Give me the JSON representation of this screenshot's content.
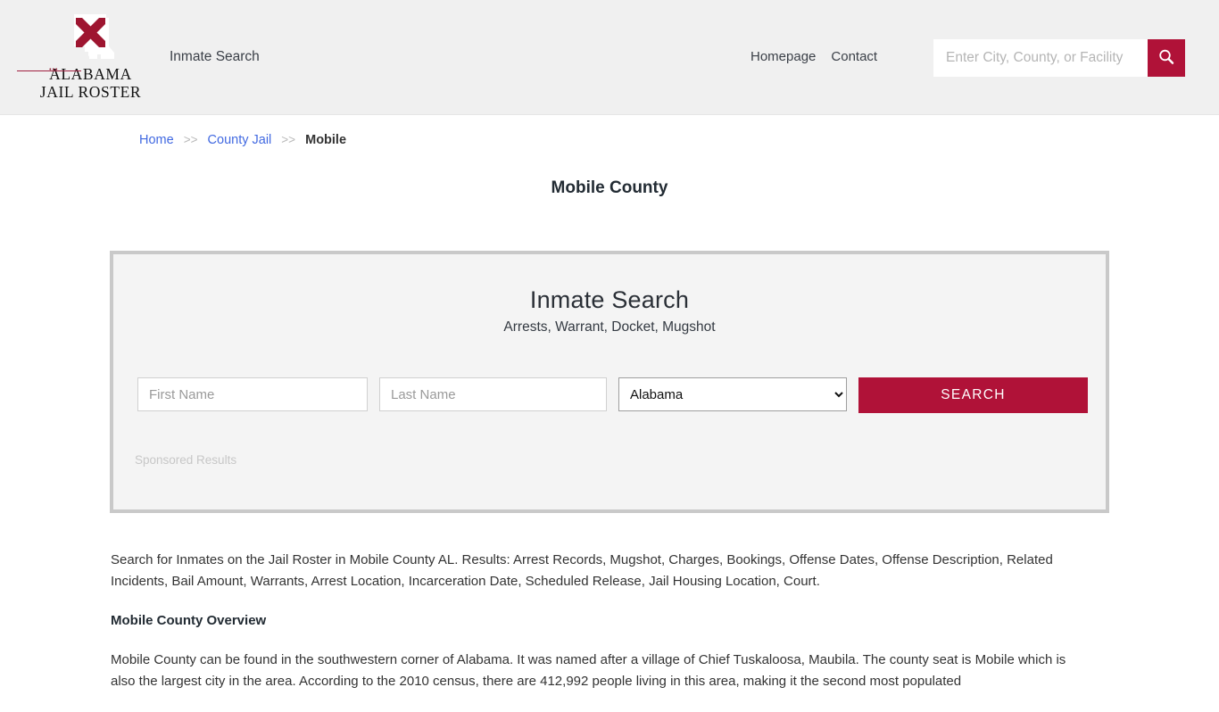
{
  "header": {
    "brand": {
      "line1": "ALABAMA",
      "line2": "JAIL ROSTER",
      "rule_dots": "•••",
      "logo_icon": "alabama-state-flag-icon"
    },
    "tagline": "Inmate Search",
    "nav": [
      {
        "label": "Homepage"
      },
      {
        "label": "Contact"
      }
    ],
    "search": {
      "placeholder": "Enter City, County, or Facility",
      "value": "",
      "button_icon": "search-icon"
    }
  },
  "breadcrumb": {
    "items": [
      {
        "label": "Home",
        "link": true
      },
      {
        "label": "County Jail",
        "link": true
      },
      {
        "label": "Mobile",
        "link": false
      }
    ],
    "separator": ">>"
  },
  "page": {
    "title": "Mobile County"
  },
  "search_panel": {
    "title": "Inmate Search",
    "subtitle": "Arrests, Warrant, Docket, Mugshot",
    "first_name": {
      "placeholder": "First Name",
      "value": ""
    },
    "last_name": {
      "placeholder": "Last Name",
      "value": ""
    },
    "state": {
      "selected": "Alabama",
      "options": [
        "Alabama"
      ]
    },
    "submit_label": "SEARCH",
    "sponsored_label": "Sponsored Results"
  },
  "content": {
    "intro": "Search for Inmates on the Jail Roster in Mobile County AL. Results: Arrest Records, Mugshot, Charges, Bookings, Offense Dates, Offense Description, Related Incidents, Bail Amount, Warrants, Arrest Location, Incarceration Date, Scheduled Release, Jail Housing Location, Court.",
    "overview_heading": "Mobile County Overview",
    "overview_text": "Mobile County can be found in the southwestern corner of Alabama. It was named after a village of Chief Tuskaloosa, Maubila. The county seat is Mobile which is also the largest city in the area. According to the 2010 census, there are 412,992 people living in this area, making it the second most populated"
  },
  "colors": {
    "brand_crimson": "#b01238",
    "header_bg": "#f0f0f0",
    "panel_bg": "#f4f4f4",
    "panel_border": "#c9c9c9",
    "link_blue": "#4169e1"
  }
}
